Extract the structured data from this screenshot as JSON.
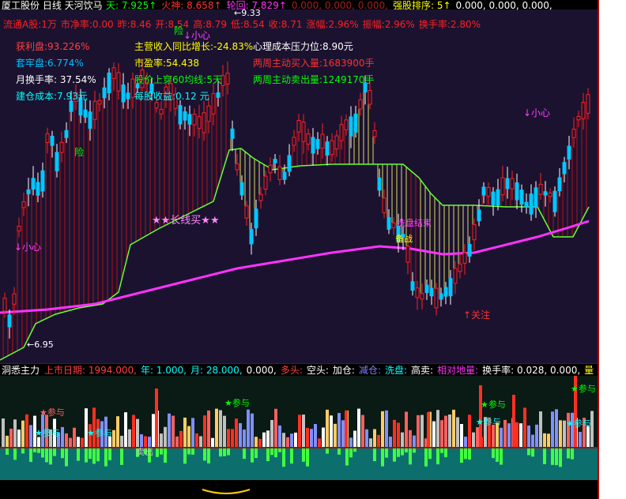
{
  "header": {
    "title": "厦工股份 日线 天河饮马",
    "indicators": [
      {
        "label": "天:",
        "value": "7.925↑",
        "color": "#00ff00"
      },
      {
        "label": "火神:",
        "value": "8.658↑",
        "color": "#ff3030"
      },
      {
        "label": "轮回:",
        "value": "7.829↑",
        "color": "#ff30ff"
      },
      {
        "label": "",
        "value": "0.000, 0.000, 0.000,",
        "color": "#a02020"
      },
      {
        "label": "强股排序:",
        "value": "5↑",
        "color": "#ffff00"
      },
      {
        "label": "",
        "value": "0.000, 0.000, 0.000,",
        "color": "#ffffff"
      }
    ]
  },
  "stats_line": {
    "items": [
      "流通A股:1万",
      "市净率:0.00",
      "昨:8.46",
      "开:8.54",
      "高:8.79",
      "低:8.54",
      "收:8.71",
      "涨幅:2.96%",
      "振幅:2.96%",
      "换手率:2.80%"
    ]
  },
  "info_left": [
    {
      "text": "获利盘:93.226%",
      "color": "#ff4040"
    },
    {
      "text": "套牢盘:6.774%",
      "color": "#00c0ff"
    },
    {
      "text": "月换手率: 37.54%",
      "color": "#ffffff"
    },
    {
      "text": "建仓成本:7.93元",
      "color": "#00ffff"
    }
  ],
  "info_mid": [
    {
      "text": "主营收入同比增长:-24.83%",
      "color": "#ffff00"
    },
    {
      "text": "市盈率:54.438",
      "color": "#ffff00"
    },
    {
      "text": "股价上穿60均线:5天",
      "color": "#00ff00"
    },
    {
      "text": "每股收益:0.12 元",
      "color": "#00ffff"
    }
  ],
  "info_right": [
    {
      "text": "心理成本压力位:8.90元",
      "color": "#ffffff"
    },
    {
      "text": "两周主动买入量:1683900手",
      "color": "#ff3030"
    },
    {
      "text": "两周主动卖出量:1249170手",
      "color": "#00ff00"
    }
  ],
  "annotations": {
    "high_price": "9.33",
    "low_price": "6.95",
    "long_buy": "★★长线买★★",
    "caution_top": "↓小心",
    "caution_left": "↓小心",
    "caution_right": "↓小心",
    "danger1": "险",
    "danger2": "险",
    "wash": "洗盘结束",
    "prepare": "备战",
    "attention": "↑关注"
  },
  "lower_panel": {
    "title": "洞悉主力",
    "items": [
      {
        "text": "上市日期: 1994.000,",
        "color": "#ff4040"
      },
      {
        "text": "年: 1.000,",
        "color": "#00ffff"
      },
      {
        "text": "月: 28.000,",
        "color": "#00ffff"
      },
      {
        "text": "0.000,",
        "color": "#ffffff"
      },
      {
        "text": "多头:",
        "color": "#ff4040"
      },
      {
        "text": "空头:",
        "color": "#ffffff"
      },
      {
        "text": "加仓:",
        "color": "#ffffff"
      },
      {
        "text": "减仓:",
        "color": "#8080ff"
      },
      {
        "text": "洗盘:",
        "color": "#00ffff"
      },
      {
        "text": "高卖:",
        "color": "#ffffff"
      },
      {
        "text": "相对地量:",
        "color": "#ff30ff"
      },
      {
        "text": "换手率: 0.028, 0.000,",
        "color": "#ffffff"
      },
      {
        "text": "量",
        "color": "#ffff00"
      }
    ],
    "labels": {
      "join": "★参与",
      "sell": "卖出"
    }
  },
  "right_axis_label": "7",
  "colors": {
    "up": "#ff2020",
    "down": "#00c8ff",
    "support": "#66ff33",
    "ma": "#ff33ff"
  }
}
